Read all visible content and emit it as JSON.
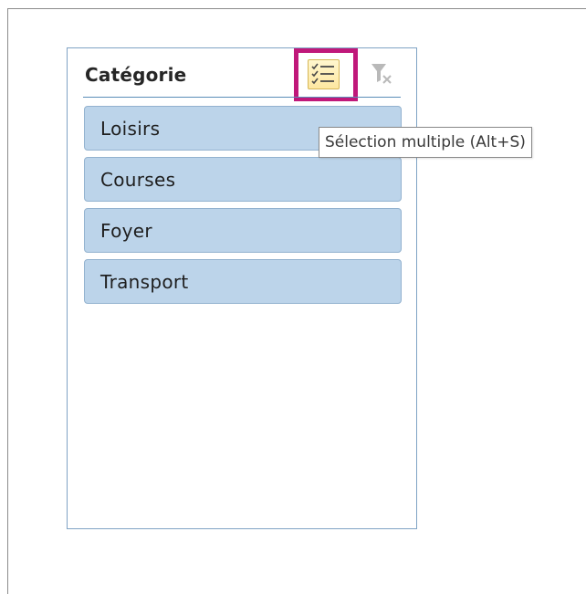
{
  "slicer": {
    "title": "Catégorie",
    "multi_select_icon": "multi-select-icon",
    "clear_filter_icon": "clear-filter-icon",
    "items": [
      {
        "label": "Loisirs"
      },
      {
        "label": "Courses"
      },
      {
        "label": "Foyer"
      },
      {
        "label": "Transport"
      }
    ]
  },
  "tooltip": {
    "text": "Sélection multiple (Alt+S)"
  },
  "colors": {
    "item_fill": "#bcd4ea",
    "highlight_border": "#c0187a",
    "slicer_border": "#7fa3c4"
  }
}
